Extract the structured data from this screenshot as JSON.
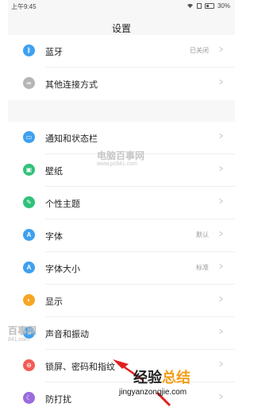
{
  "statusbar": {
    "time": "上午9:45",
    "battery": "30%"
  },
  "header": {
    "title": "设置"
  },
  "group1": [
    {
      "label": "蓝牙",
      "value": "已关闭",
      "icon": "bluetooth-icon",
      "color": "#3ea0ef"
    },
    {
      "label": "其他连接方式",
      "value": "",
      "icon": "link-icon",
      "color": "#b5b5b5"
    }
  ],
  "group2": [
    {
      "label": "通知和状态栏",
      "value": "",
      "icon": "notification-icon",
      "color": "#3ea0ef"
    },
    {
      "label": "壁纸",
      "value": "",
      "icon": "wallpaper-icon",
      "color": "#31c17a"
    },
    {
      "label": "个性主题",
      "value": "",
      "icon": "theme-icon",
      "color": "#31c17a"
    },
    {
      "label": "字体",
      "value": "默认",
      "icon": "font-icon",
      "color": "#3ea0ef"
    },
    {
      "label": "字体大小",
      "value": "标准",
      "icon": "font-size-icon",
      "color": "#3ea0ef"
    },
    {
      "label": "显示",
      "value": "",
      "icon": "display-icon",
      "color": "#f7a623"
    },
    {
      "label": "声音和振动",
      "value": "",
      "icon": "sound-icon",
      "color": "#3ea0ef"
    },
    {
      "label": "锁屏、密码和指纹",
      "value": "",
      "icon": "lock-icon",
      "color": "#f25d56"
    },
    {
      "label": "防打扰",
      "value": "",
      "icon": "do-not-disturb-icon",
      "color": "#9a6cdd"
    }
  ],
  "watermarks": {
    "center_title": "电脑百事网",
    "center_url": "www.pc841.com",
    "left_title": "百事网",
    "left_url": "841.com",
    "jy_part1": "经验",
    "jy_part2": "总结",
    "jy_url": "jingyanzongjie.com"
  }
}
